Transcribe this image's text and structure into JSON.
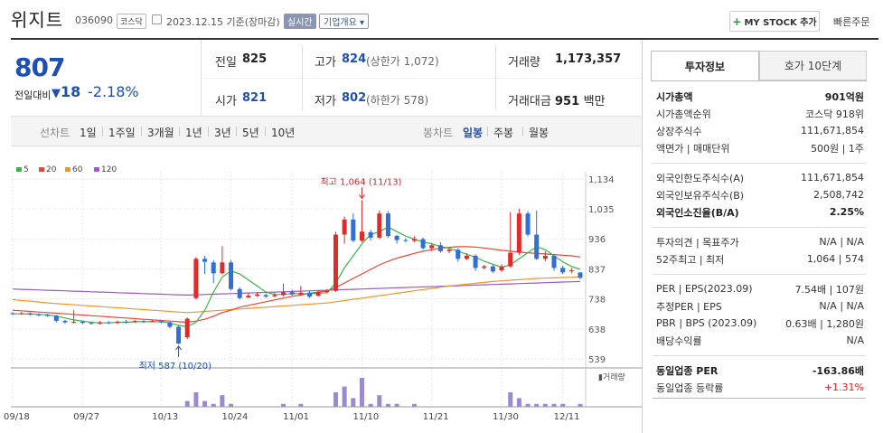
{
  "header": {
    "name": "위지트",
    "code": "036090",
    "market": "코스닥",
    "date_basis": "2023.12.15 기준(장마감)",
    "realtime": "실시간",
    "corp_info": "기업개요",
    "mystock": "MY STOCK 추가",
    "quick_order": "빠른주문"
  },
  "quote": {
    "price": "807",
    "prev_label": "전일대비",
    "change": "18",
    "change_pct": "-2.18%",
    "prev_label2": "전일",
    "prev_val": "825",
    "open_label": "시가",
    "open_val": "821",
    "high_label": "고가",
    "high_val": "824",
    "high_sub": "(상한가 1,072)",
    "low_label": "저가",
    "low_val": "802",
    "low_sub": "(하한가 578)",
    "vol_label": "거래량",
    "vol_val": "1,173,357",
    "amt_label": "거래대금",
    "amt_val": "951",
    "amt_unit": "백만"
  },
  "period_bar": {
    "line_label": "선차트",
    "line_opts": [
      "1일",
      "1주일",
      "3개월",
      "1년",
      "3년",
      "5년",
      "10년"
    ],
    "candle_label": "봉차트",
    "candle_opts": [
      "일봉",
      "주봉",
      "월봉"
    ],
    "candle_selected": "일봉"
  },
  "legend": [
    "5",
    "20",
    "60",
    "120"
  ],
  "colors": {
    "ma5": "#3ab34a",
    "ma20": "#e5463a",
    "ma60": "#f0962e",
    "ma120": "#9a5cc6",
    "up": "#e02b2b",
    "down": "#2f6fd6",
    "volume": "#9b8ad0"
  },
  "chart_data": {
    "type": "candlestick",
    "y_ticks": [
      "1,134",
      "1,035",
      "936",
      "837",
      "738",
      "638",
      "539"
    ],
    "x_ticks": [
      "09/18",
      "09/27",
      "10/13",
      "10/24",
      "11/01",
      "11/10",
      "11/21",
      "11/30",
      "12/11"
    ],
    "max_label": "최고 1,064 (11/13)",
    "min_label": "최저 587 (10/20)",
    "volume_label": "거래량",
    "candles": [
      [
        690,
        688,
        694,
        684
      ],
      [
        688,
        690,
        694,
        685
      ],
      [
        690,
        686,
        692,
        682
      ],
      [
        686,
        684,
        690,
        680
      ],
      [
        684,
        682,
        688,
        678
      ],
      [
        682,
        665,
        684,
        660
      ],
      [
        665,
        660,
        668,
        655
      ],
      [
        660,
        662,
        700,
        656
      ],
      [
        662,
        658,
        666,
        654
      ],
      [
        658,
        656,
        662,
        652
      ],
      [
        656,
        660,
        664,
        652
      ],
      [
        660,
        658,
        664,
        654
      ],
      [
        658,
        662,
        666,
        654
      ],
      [
        662,
        660,
        668,
        656
      ],
      [
        660,
        664,
        668,
        658
      ],
      [
        664,
        662,
        668,
        658
      ],
      [
        662,
        664,
        668,
        660
      ],
      [
        664,
        660,
        668,
        656
      ],
      [
        660,
        645,
        662,
        640
      ],
      [
        645,
        590,
        650,
        587
      ],
      [
        610,
        672,
        676,
        605
      ],
      [
        740,
        870,
        876,
        735
      ],
      [
        870,
        860,
        880,
        820
      ],
      [
        858,
        822,
        866,
        790
      ],
      [
        822,
        858,
        912,
        818
      ],
      [
        858,
        770,
        866,
        765
      ],
      [
        770,
        740,
        776,
        735
      ],
      [
        742,
        748,
        756,
        740
      ],
      [
        748,
        752,
        760,
        744
      ],
      [
        750,
        745,
        756,
        740
      ],
      [
        746,
        750,
        758,
        742
      ],
      [
        750,
        760,
        788,
        745
      ],
      [
        760,
        752,
        768,
        748
      ],
      [
        752,
        758,
        780,
        748
      ],
      [
        758,
        745,
        764,
        740
      ],
      [
        748,
        760,
        766,
        744
      ],
      [
        760,
        764,
        770,
        755
      ],
      [
        764,
        950,
        960,
        760
      ],
      [
        950,
        1000,
        1010,
        920
      ],
      [
        1000,
        930,
        1020,
        925
      ],
      [
        930,
        960,
        1064,
        925
      ],
      [
        958,
        940,
        966,
        930
      ],
      [
        940,
        1020,
        1030,
        935
      ],
      [
        1020,
        945,
        1028,
        940
      ],
      [
        946,
        932,
        950,
        920
      ],
      [
        932,
        930,
        938,
        925
      ],
      [
        930,
        935,
        945,
        925
      ],
      [
        935,
        905,
        940,
        900
      ],
      [
        905,
        915,
        920,
        895
      ],
      [
        915,
        895,
        925,
        890
      ],
      [
        895,
        900,
        905,
        888
      ],
      [
        900,
        870,
        905,
        860
      ],
      [
        870,
        880,
        888,
        866
      ],
      [
        880,
        840,
        885,
        830
      ],
      [
        840,
        845,
        850,
        835
      ],
      [
        845,
        828,
        852,
        822
      ],
      [
        832,
        845,
        852,
        826
      ],
      [
        845,
        890,
        1025,
        840
      ],
      [
        890,
        1020,
        1035,
        882
      ],
      [
        1020,
        950,
        1028,
        944
      ],
      [
        950,
        870,
        1030,
        866
      ],
      [
        870,
        880,
        895,
        862
      ],
      [
        880,
        840,
        882,
        830
      ],
      [
        840,
        825,
        848,
        820
      ],
      [
        830,
        832,
        840,
        822
      ],
      [
        825,
        807,
        824,
        802
      ]
    ],
    "volumes": [
      0,
      0,
      0,
      0,
      0,
      0,
      0,
      0,
      0,
      0,
      0,
      0,
      0,
      0,
      0,
      0,
      0,
      0,
      0,
      0,
      2,
      5,
      2,
      1,
      4,
      1,
      0,
      0,
      0,
      0,
      0,
      1,
      0,
      1,
      0,
      0,
      0,
      5,
      7,
      3,
      10,
      1,
      4,
      1,
      1,
      0,
      1,
      0,
      0,
      0,
      0,
      0,
      0,
      0,
      0,
      0,
      0,
      5,
      3,
      1,
      1,
      1,
      1,
      1,
      0,
      1
    ],
    "ma5": [
      688,
      688,
      687,
      686,
      685,
      680,
      674,
      668,
      664,
      660,
      658,
      658,
      660,
      660,
      662,
      662,
      662,
      662,
      658,
      650,
      645,
      660,
      700,
      760,
      810,
      830,
      820,
      800,
      780,
      760,
      752,
      752,
      755,
      755,
      754,
      756,
      758,
      790,
      840,
      880,
      920,
      950,
      960,
      975,
      960,
      945,
      935,
      925,
      920,
      910,
      905,
      895,
      885,
      875,
      862,
      852,
      842,
      850,
      870,
      890,
      910,
      900,
      880,
      860,
      845,
      835
    ],
    "ma20": [
      700,
      698,
      696,
      694,
      692,
      690,
      688,
      686,
      684,
      682,
      680,
      678,
      676,
      674,
      672,
      670,
      668,
      666,
      664,
      662,
      660,
      664,
      670,
      680,
      692,
      700,
      710,
      716,
      722,
      728,
      734,
      740,
      746,
      750,
      756,
      760,
      764,
      775,
      790,
      805,
      820,
      835,
      850,
      862,
      872,
      880,
      888,
      895,
      900,
      905,
      908,
      910,
      910,
      909,
      906,
      902,
      898,
      895,
      892,
      890,
      888,
      886,
      884,
      882,
      880,
      876
    ],
    "ma60": [
      735,
      732,
      730,
      727,
      724,
      722,
      720,
      718,
      716,
      714,
      712,
      710,
      708,
      706,
      704,
      702,
      700,
      698,
      696,
      694,
      692,
      694,
      696,
      698,
      700,
      702,
      704,
      706,
      708,
      710,
      712,
      714,
      716,
      718,
      720,
      722,
      724,
      728,
      732,
      736,
      740,
      744,
      748,
      752,
      756,
      760,
      764,
      768,
      772,
      776,
      780,
      783,
      786,
      789,
      792,
      795,
      797,
      799,
      801,
      803,
      805,
      806,
      807,
      808,
      809,
      810
    ],
    "ma120": [
      770,
      769,
      768,
      767,
      766,
      765,
      764,
      763,
      762,
      761,
      760,
      759,
      758,
      757,
      756,
      755,
      754,
      753,
      752,
      751,
      750,
      751,
      752,
      753,
      754,
      755,
      756,
      757,
      758,
      759,
      760,
      761,
      762,
      763,
      764,
      765,
      766,
      767,
      768,
      769,
      770,
      771,
      772,
      773,
      774,
      775,
      776,
      777,
      778,
      779,
      780,
      781,
      782,
      783,
      784,
      785,
      786,
      787,
      788,
      789,
      790,
      791,
      792,
      793,
      794,
      795
    ]
  },
  "invest_panel": {
    "tab1": "투자정보",
    "tab2": "호가 10단계",
    "rows": [
      {
        "l": "시가총액",
        "v": "901억원",
        "bold": true
      },
      {
        "l": "시가총액순위",
        "v": "코스닥 918위"
      },
      {
        "l": "상장주식수",
        "v": "111,671,854"
      },
      {
        "l": "액면가 | 매매단위",
        "v": "500원 | 1주"
      },
      {
        "l": "외국인한도주식수(A)",
        "v": "111,671,854"
      },
      {
        "l": "외국인보유주식수(B)",
        "v": "2,508,742"
      },
      {
        "l": "외국인소진율(B/A)",
        "v": "2.25%",
        "bold": true
      },
      {
        "l": "투자의견 | 목표주가",
        "v": "N/A | N/A"
      },
      {
        "l": "52주최고 | 최저",
        "v": "1,064 | 574"
      },
      {
        "l": "PER | EPS(2023.09)",
        "v": "7.54배 | 107원"
      },
      {
        "l": "추정PER | EPS",
        "v": "N/A | N/A"
      },
      {
        "l": "PBR | BPS (2023.09)",
        "v": "0.63배 | 1,280원"
      },
      {
        "l": "배당수익률",
        "v": "N/A"
      },
      {
        "l": "동일업종 PER",
        "v": "-163.86배",
        "bold": true
      },
      {
        "l": "동일업종 등락률",
        "v": "+1.31%",
        "red": true
      }
    ]
  }
}
